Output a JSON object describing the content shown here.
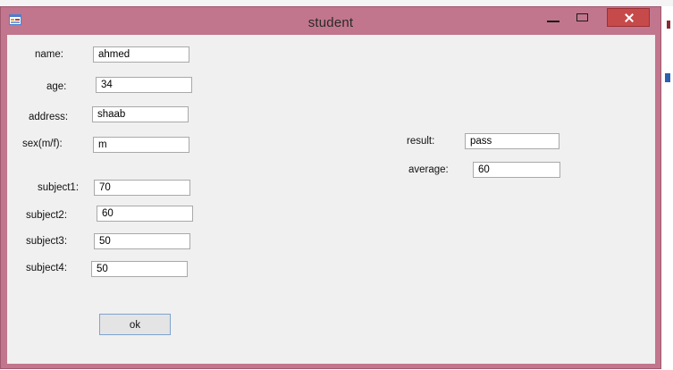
{
  "window": {
    "title": "student"
  },
  "form": {
    "name_label": "name:",
    "name_value": "ahmed",
    "age_label": "age:",
    "age_value": "34",
    "address_label": "address:",
    "address_value": "shaab",
    "sex_label": "sex(m/f):",
    "sex_value": "m",
    "subject1_label": "subject1:",
    "subject1_value": "70",
    "subject2_label": "subject2:",
    "subject2_value": "60",
    "subject3_label": "subject3:",
    "subject3_value": "50",
    "subject4_label": "subject4:",
    "subject4_value": "50",
    "result_label": "result:",
    "result_value": "pass",
    "average_label": "average:",
    "average_value": "60",
    "ok_label": "ok"
  },
  "icons": [
    "app-icon",
    "minimize-icon",
    "maximize-icon",
    "close-icon"
  ],
  "colors": {
    "window_frame": "#c1768d",
    "client_bg": "#f0f0f0",
    "close_button": "#c74a4a"
  }
}
